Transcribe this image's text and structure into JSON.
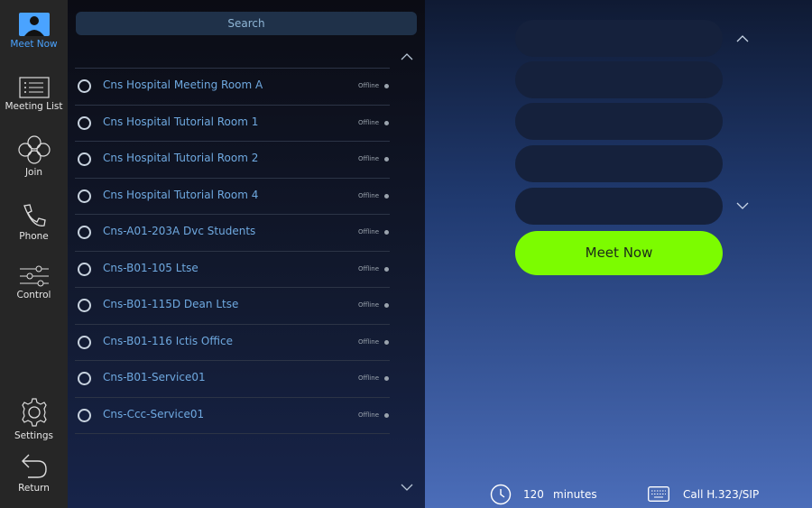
{
  "sidebar": {
    "items": [
      {
        "label": "Meet Now"
      },
      {
        "label": "Meeting List"
      },
      {
        "label": "Join"
      },
      {
        "label": "Phone"
      },
      {
        "label": "Control"
      },
      {
        "label": "Settings"
      },
      {
        "label": "Return"
      }
    ]
  },
  "list_panel": {
    "search_label": "Search",
    "rooms": [
      {
        "name": "Cns Hospital Meeting Room A",
        "status": "Offline"
      },
      {
        "name": "Cns Hospital Tutorial Room 1",
        "status": "Offline"
      },
      {
        "name": "Cns Hospital Tutorial Room 2",
        "status": "Offline"
      },
      {
        "name": "Cns Hospital Tutorial Room 4",
        "status": "Offline"
      },
      {
        "name": "Cns-A01-203A Dvc Students",
        "status": "Offline"
      },
      {
        "name": "Cns-B01-105 Ltse",
        "status": "Offline"
      },
      {
        "name": "Cns-B01-115D Dean Ltse",
        "status": "Offline"
      },
      {
        "name": "Cns-B01-116 Ictis Office",
        "status": "Offline"
      },
      {
        "name": "Cns-B01-Service01",
        "status": "Offline"
      },
      {
        "name": "Cns-Ccc-Service01",
        "status": "Offline"
      }
    ]
  },
  "right_panel": {
    "meet_now_label": "Meet Now",
    "duration_value": "120",
    "duration_unit": "minutes",
    "call_type_label": "Call H.323/SIP"
  },
  "colors": {
    "accent": "#7cfc00",
    "active_nav": "#4aa3ff",
    "room_text": "#6fa9e0"
  }
}
